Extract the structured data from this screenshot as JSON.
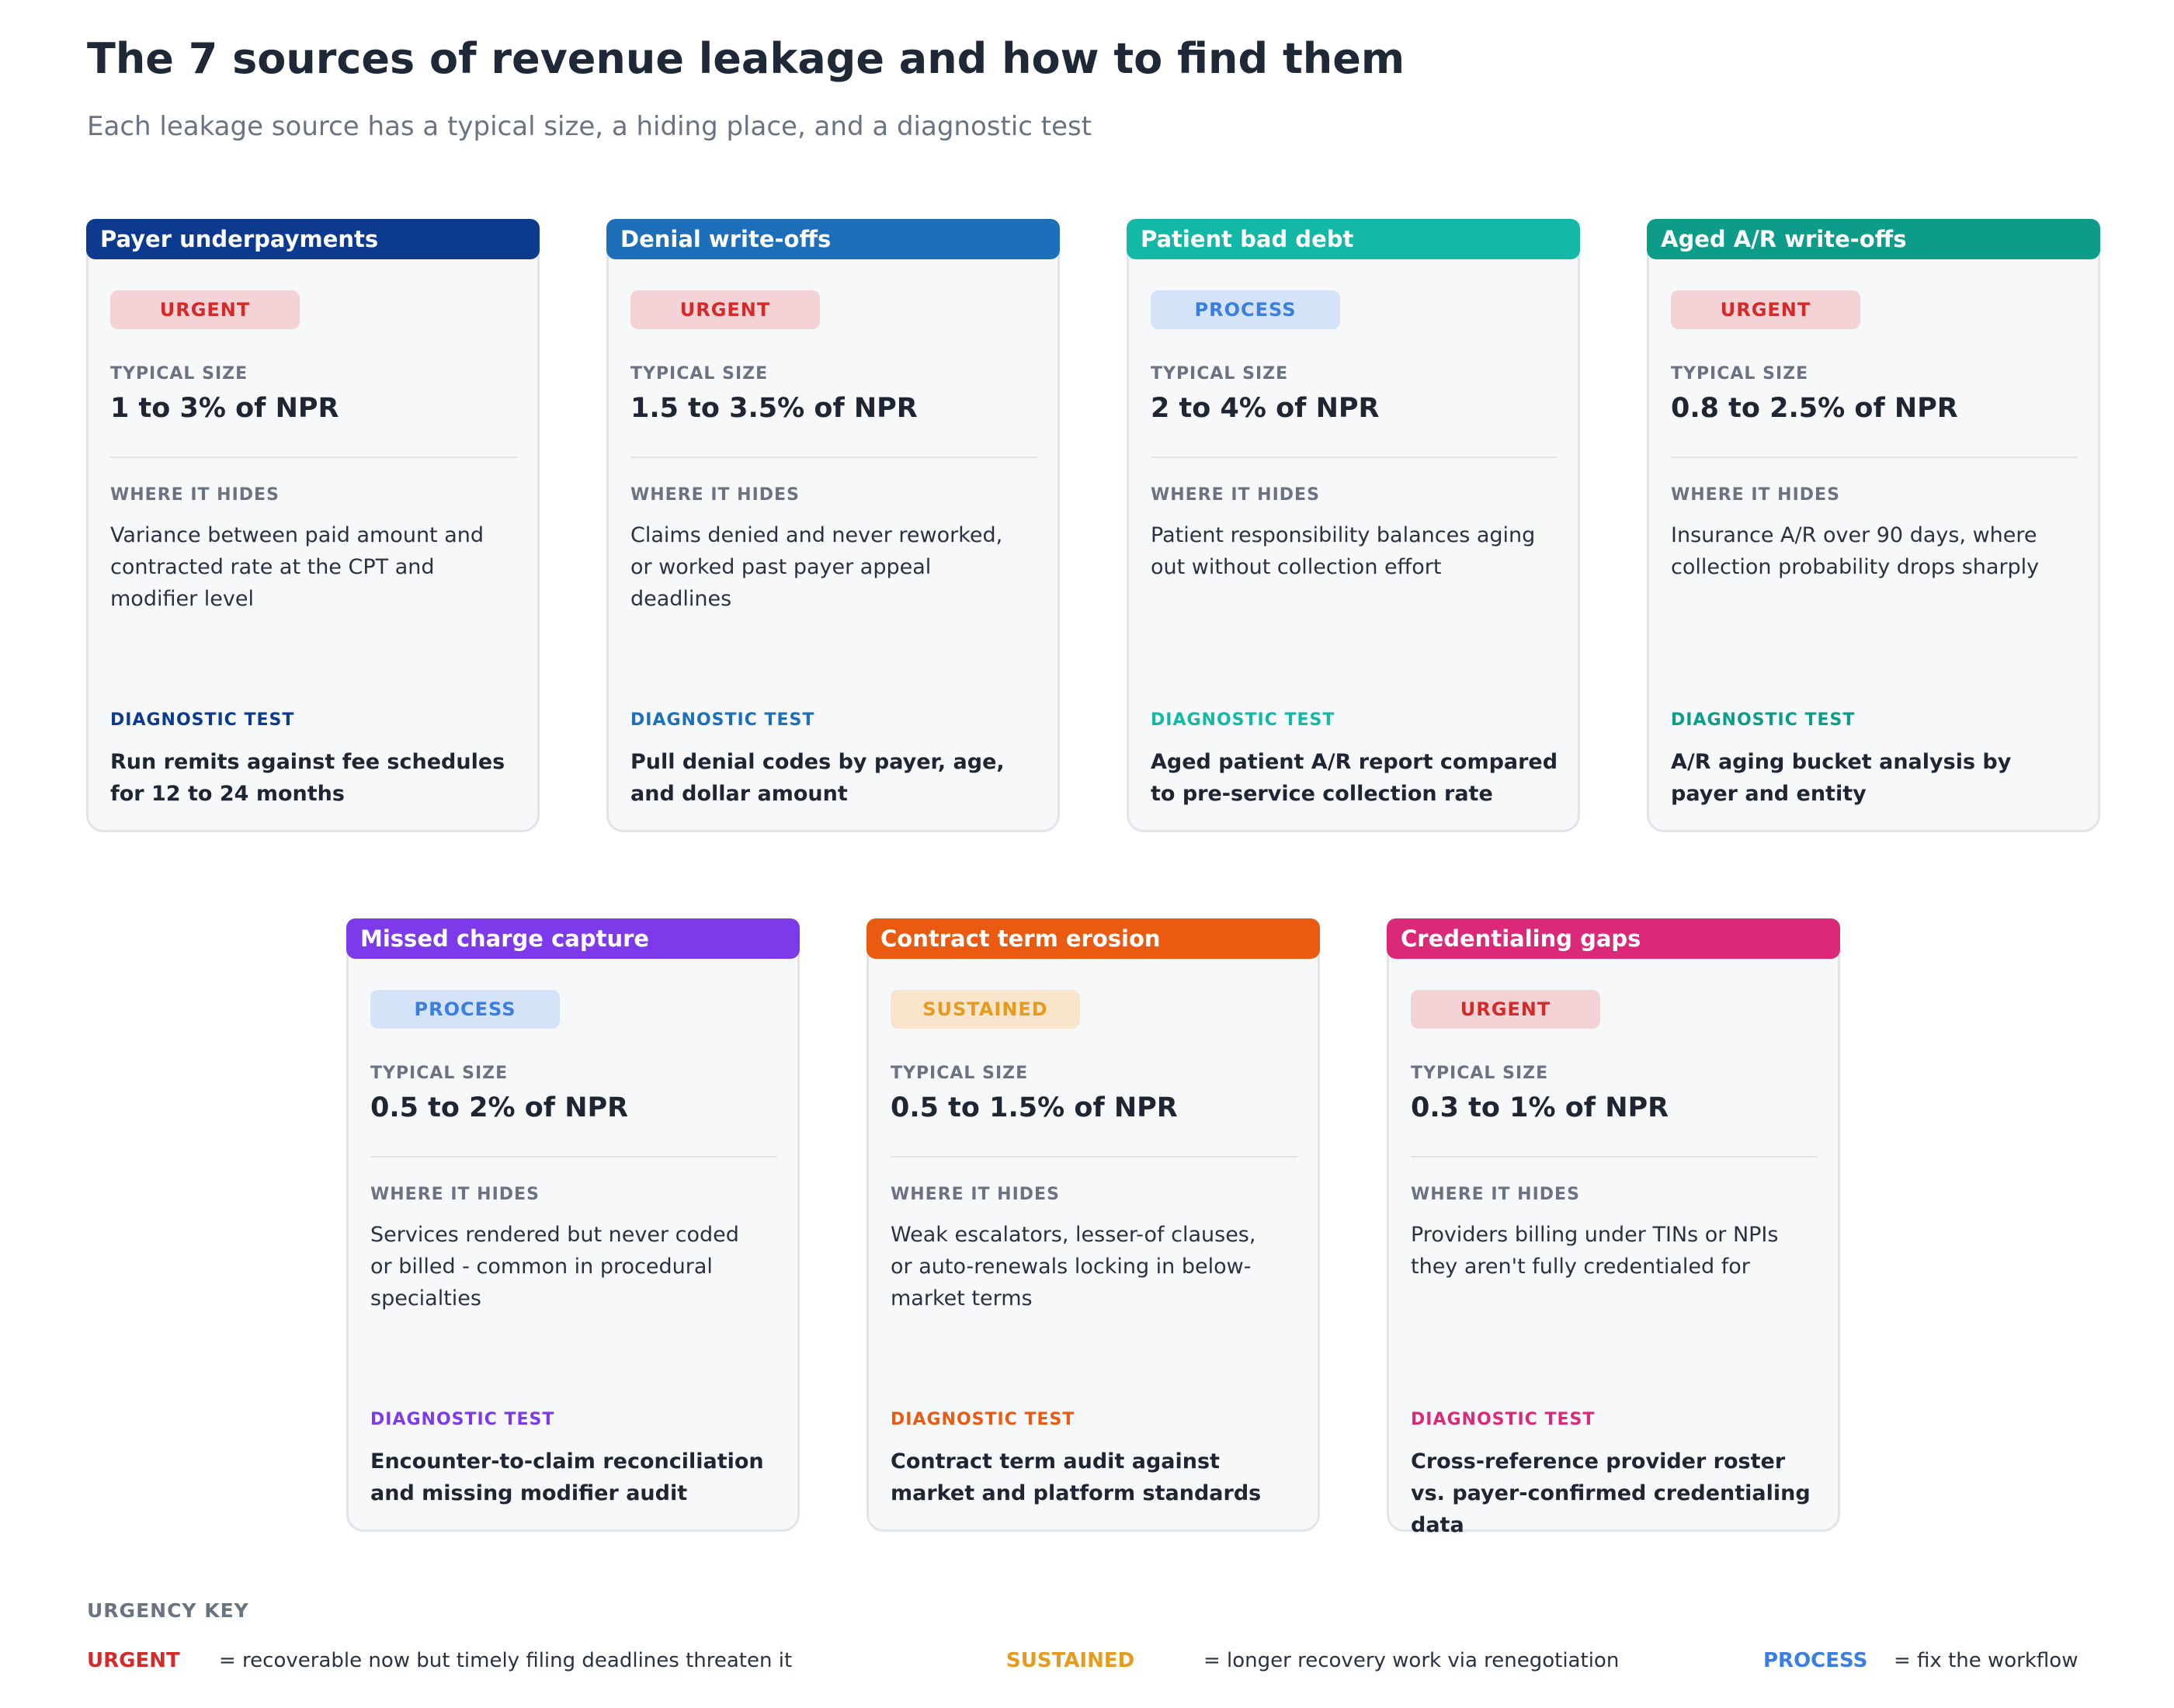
{
  "title": "The 7 sources of revenue leakage and how to find them",
  "subtitle": "Each leakage source has a typical size, a hiding place, and a diagnostic test",
  "labels": {
    "typical_size": "TYPICAL SIZE",
    "where_it_hides": "WHERE IT HIDES",
    "diagnostic_test": "DIAGNOSTIC TEST"
  },
  "colors": {
    "urgent_text": "#d42a2a",
    "urgent_bg": "#f4d3d7",
    "process_text": "#3a7fe0",
    "process_bg": "#d4e3f8",
    "sustained_text": "#e79b1e",
    "sustained_bg": "#f9e5cc"
  },
  "cards": [
    {
      "title": "Payer underpayments",
      "accent": "#0c3a8e",
      "badge": "URGENT",
      "badge_type": "urgent",
      "size": "1 to 3% of NPR",
      "hides": "Variance between paid amount and contracted rate at the CPT and modifier level",
      "test": "Run remits against fee schedules for 12 to 24 months"
    },
    {
      "title": "Denial write-offs",
      "accent": "#1c6fb8",
      "badge": "URGENT",
      "badge_type": "urgent",
      "size": "1.5 to 3.5% of NPR",
      "hides": "Claims denied and never reworked, or worked past payer appeal deadlines",
      "test": "Pull denial codes by payer, age, and dollar amount"
    },
    {
      "title": "Patient bad debt",
      "accent": "#13b8a6",
      "badge": "PROCESS",
      "badge_type": "process",
      "size": "2 to 4% of NPR",
      "hides": "Patient responsibility balances aging out without collection effort",
      "test": "Aged patient A/R report compared to pre-service collection rate"
    },
    {
      "title": "Aged A/R write-offs",
      "accent": "#0d9b8a",
      "badge": "URGENT",
      "badge_type": "urgent",
      "size": "0.8 to 2.5% of NPR",
      "hides": "Insurance A/R over 90 days, where collection probability drops sharply",
      "test": "A/R aging bucket analysis by payer and entity"
    },
    {
      "title": "Missed charge capture",
      "accent": "#7c3aeb",
      "badge": "PROCESS",
      "badge_type": "process",
      "size": "0.5 to 2% of NPR",
      "hides": "Services rendered but never coded or billed - common in procedural specialties",
      "test": "Encounter-to-claim reconciliation and missing modifier audit"
    },
    {
      "title": "Contract term erosion",
      "accent": "#ea5a10",
      "badge": "SUSTAINED",
      "badge_type": "sustained",
      "size": "0.5 to 1.5% of NPR",
      "hides": "Weak escalators, lesser-of clauses, or auto-renewals locking in below-market terms",
      "test": "Contract term audit against market and platform standards"
    },
    {
      "title": "Credentialing gaps",
      "accent": "#db2878",
      "badge": "URGENT",
      "badge_type": "urgent",
      "size": "0.3 to 1% of NPR",
      "hides": "Providers billing under TINs or NPIs they aren't fully credentialed for",
      "test": "Cross-reference provider roster vs. payer-confirmed credentialing data"
    }
  ],
  "key": {
    "title": "URGENCY KEY",
    "items": [
      {
        "code": "URGENT",
        "desc": "= recoverable now but timely filing deadlines threaten it"
      },
      {
        "code": "SUSTAINED",
        "desc": "= longer recovery work via renegotiation"
      },
      {
        "code": "PROCESS",
        "desc": "= fix the workflow"
      }
    ]
  }
}
